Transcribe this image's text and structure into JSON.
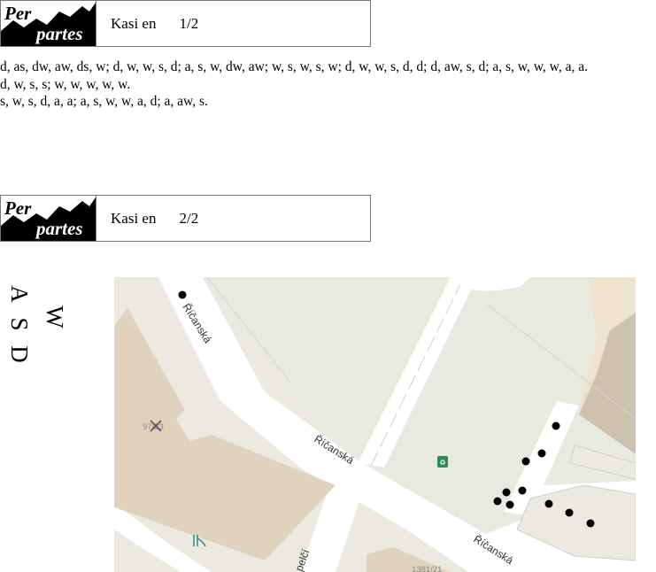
{
  "headers": [
    {
      "logo_top": "Per",
      "logo_bottom": "partes",
      "title": "Kasi en",
      "page": "1/2"
    },
    {
      "logo_top": "Per",
      "logo_bottom": "partes",
      "title": "Kasi en",
      "page": "2/2"
    }
  ],
  "lines": [
    "d, as, dw, aw, ds, w; d, w, w, s, d; a, s, w, dw, aw; w, s, w, s, w; d, w, w, s, d, d; d, aw, s, d; a, s, w, w, w, a, a.",
    "d, w, s, s; w, w, w, w, w.",
    "s, w, s, d, a, a; a, s, w, w, a, d; a, aw, s."
  ],
  "legend": {
    "w": "W",
    "a": "A",
    "s": "S",
    "d": "D"
  },
  "map": {
    "streets": [
      "Říčanská",
      "Říčanská",
      "Říčanská",
      "pelčí"
    ],
    "parcels": [
      "97/23",
      "1381/21"
    ],
    "icons": [
      "restaurant-icon",
      "recycling-icon",
      "playground-icon"
    ],
    "colors": {
      "building": "#e0d3bd",
      "ground": "#eae8df",
      "street": "#ffffff",
      "recycling": "#2e8b57"
    }
  }
}
